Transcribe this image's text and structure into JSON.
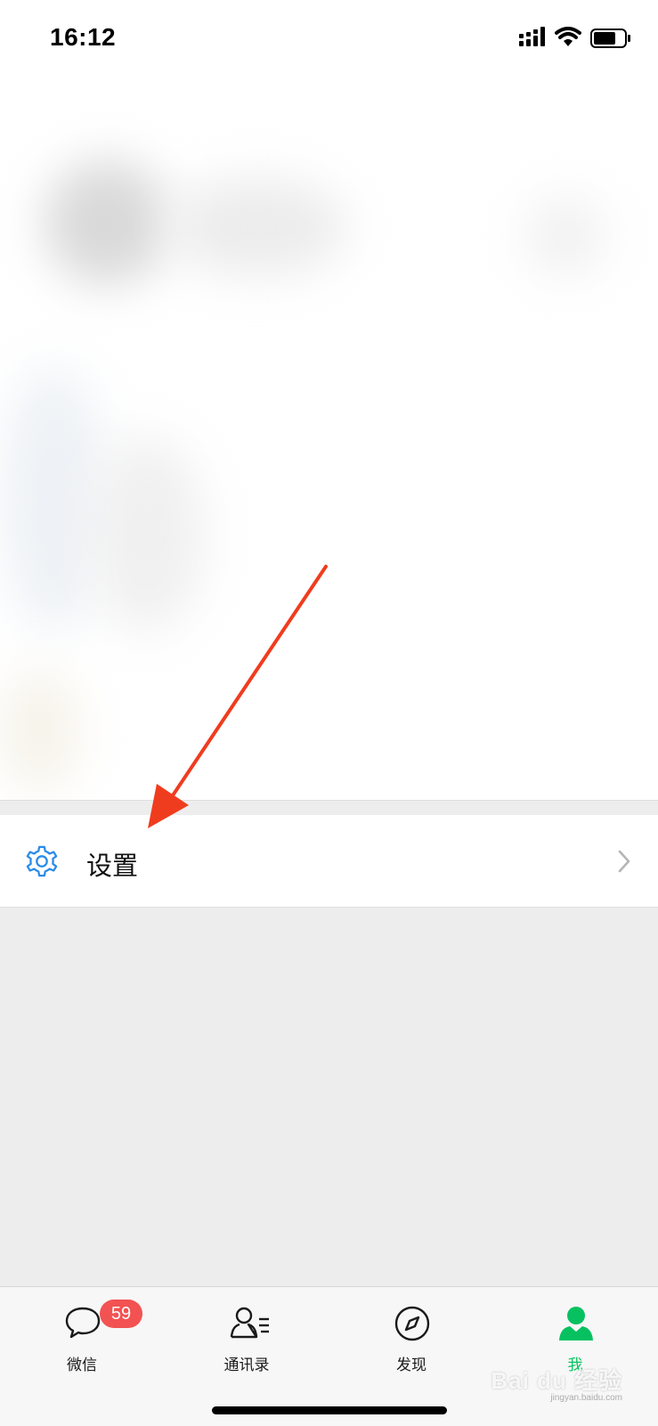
{
  "status_bar": {
    "time": "16:12",
    "icons": [
      "signal-icon",
      "wifi-icon",
      "battery-icon"
    ]
  },
  "settings_row": {
    "icon": "gear-icon",
    "label": "设置",
    "accent_color": "#2b8be8"
  },
  "tab_bar": {
    "active_color": "#07c160",
    "tabs": [
      {
        "label": "微信",
        "icon": "chat-bubble-icon",
        "badge": "59",
        "active": false
      },
      {
        "label": "通讯录",
        "icon": "contacts-icon",
        "active": false
      },
      {
        "label": "发现",
        "icon": "compass-icon",
        "active": false
      },
      {
        "label": "我",
        "icon": "person-icon",
        "active": true
      }
    ]
  },
  "watermark": {
    "text": "Bai du 经验",
    "subtext": "jingyan.baidu.com"
  },
  "annotation": {
    "type": "red-arrow-icon",
    "color": "#f03c1e"
  }
}
